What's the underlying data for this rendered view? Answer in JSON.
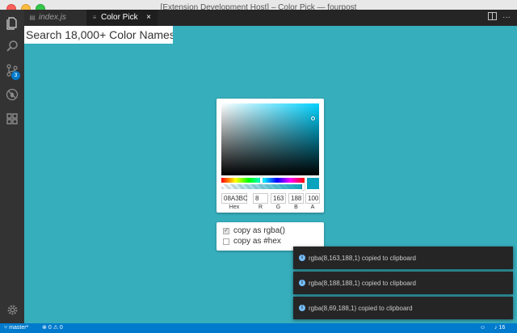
{
  "window": {
    "title": "[Extension Development Host] – Color Pick — fourpost"
  },
  "tabs": [
    {
      "label": "index.js"
    },
    {
      "label": "Color Pick",
      "close": "×"
    }
  ],
  "activity_bar": {
    "icons": [
      "files-icon",
      "search-icon",
      "source-control-icon",
      "debug-icon",
      "extensions-icon",
      "gear-icon"
    ],
    "source_control_badge": "3"
  },
  "webview": {
    "background": "#37aebc",
    "search": {
      "placeholder": "Search 18,000+ Color Names",
      "value": ""
    },
    "picker": {
      "hex": "08A3BC",
      "r": "8",
      "g": "163",
      "b": "188",
      "a": "100",
      "labels": {
        "hex": "Hex",
        "r": "R",
        "g": "G",
        "b": "B",
        "a": "A"
      },
      "swatch_color": "#08a3bc"
    },
    "copy_options": [
      {
        "label": "copy as rgba()",
        "checked": true
      },
      {
        "label": "copy as #hex",
        "checked": false
      }
    ]
  },
  "notifications": [
    {
      "text": "rgba(8,163,188,1) copied to clipboard"
    },
    {
      "text": "rgba(8,188,188,1) copied to clipboard"
    },
    {
      "text": "rgba(8,69,188,1) copied to clipboard"
    }
  ],
  "status_bar": {
    "branch": "master*",
    "errors": "0",
    "warnings": "0",
    "notifications": "16"
  }
}
